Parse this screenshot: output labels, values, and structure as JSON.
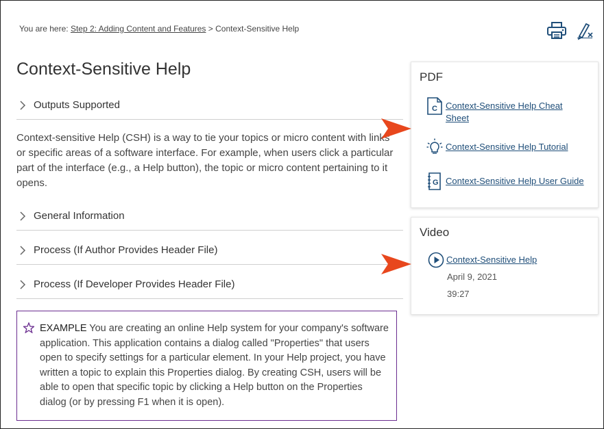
{
  "breadcrumb": {
    "prefix": "You are here: ",
    "link": "Step 2: Adding Content and Features",
    "separator": " > ",
    "current": "Context-Sensitive Help"
  },
  "toolbar": {
    "print_icon": "print-icon",
    "clear_highlight_icon": "clear-highlight-icon"
  },
  "page": {
    "title": "Context-Sensitive Help"
  },
  "dropdowns": [
    {
      "label": "Outputs Supported"
    },
    {
      "label": "General Information"
    },
    {
      "label": "Process (If Author Provides Header File)"
    },
    {
      "label": "Process (If Developer Provides Header File)"
    }
  ],
  "intro": "Context-sensitive Help (CSH) is a way to tie your topics or micro content with links or specific areas of a software interface. For example, when users click a particular part of the interface (e.g., a Help button), the topic or micro content pertaining to it opens.",
  "example": {
    "tag": "EXAMPLE",
    "text": " You are creating an online Help system for your company's software application. This application contains a dialog called \"Properties\" that users open to specify settings for a particular element. In your Help project, you have written a topic to explain this Properties dialog. By creating CSH, users will be able to open that specific topic by clicking a Help button on the Properties dialog (or by pressing F1 when it is open)."
  },
  "sidebar": {
    "pdf": {
      "title": "PDF",
      "items": [
        {
          "label": "Context-Sensitive Help Cheat Sheet",
          "icon": "cheat-sheet-icon",
          "letter": "C"
        },
        {
          "label": "Context-Sensitive Help Tutorial",
          "icon": "lightbulb-icon"
        },
        {
          "label": "Context-Sensitive Help User Guide",
          "icon": "user-guide-icon",
          "letter": "G"
        }
      ]
    },
    "video": {
      "title": "Video",
      "item": {
        "label": "Context-Sensitive Help",
        "icon": "play-icon"
      },
      "date": "April 9, 2021",
      "duration": "39:27"
    }
  },
  "colors": {
    "link": "#1f4e79",
    "example_border": "#6a2c8f",
    "arrow": "#e8471d"
  }
}
